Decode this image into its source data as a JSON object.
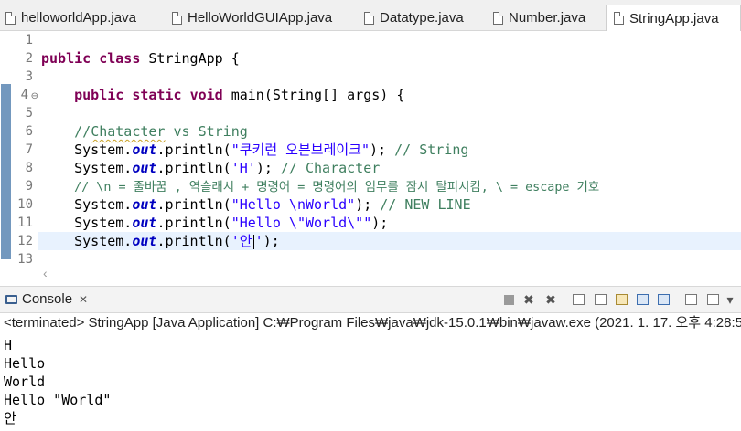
{
  "tabs": [
    {
      "label": "helloworldApp.java"
    },
    {
      "label": "HelloWorldGUIApp.java"
    },
    {
      "label": "Datatype.java"
    },
    {
      "label": "Number.java"
    },
    {
      "label": "StringApp.java",
      "active": true
    }
  ],
  "editor": {
    "line_numbers": [
      "1",
      "2",
      "3",
      "4",
      "5",
      "6",
      "7",
      "8",
      "9",
      "10",
      "11",
      "12",
      "13"
    ],
    "code": {
      "l2_public": "public",
      "l2_class": "class",
      "l2_name": " StringApp {",
      "l4_public": "public",
      "l4_static": "static",
      "l4_void": "void",
      "l4_rest": " main(String[] args) {",
      "l6_slashes": "//",
      "l6_word": "Chatacter",
      "l6_rest": " vs String",
      "sys": "System.",
      "out": "out",
      "println": ".println(",
      "l7_str": "\"쿠키런 오븐브레이크\"",
      "l7_end": "); ",
      "l7_cm": "// String",
      "l8_str": "'H'",
      "l8_end": "); ",
      "l8_cm": "// Character",
      "l9_cm": "// \\n = 줄바꿈 , 역슬래시 + 명령어 = 명령어의 임무를 잠시 탈피시킴, \\ = escape 기호",
      "l10_str": "\"Hello \\nWorld\"",
      "l10_end": "); ",
      "l10_cm": "// NEW LINE",
      "l11_str": "\"Hello \\\"World\\\"\"",
      "l11_end": ");",
      "l12_str_a": "'안",
      "l12_str_b": "'",
      "l12_end": ");"
    }
  },
  "console": {
    "title": "Console",
    "close": "✕",
    "terminated": "<terminated> StringApp [Java Application] C:₩Program Files₩java₩jdk-15.0.1₩bin₩javaw.exe  (2021. 1. 17. 오후 4:28:5",
    "output": [
      "H",
      "Hello",
      "World",
      "Hello \"World\"",
      "안"
    ]
  },
  "icons": {
    "fold": "⊖",
    "scroll_left": "‹",
    "remove": "✖",
    "remove_all": "✖",
    "menu": "▾"
  }
}
